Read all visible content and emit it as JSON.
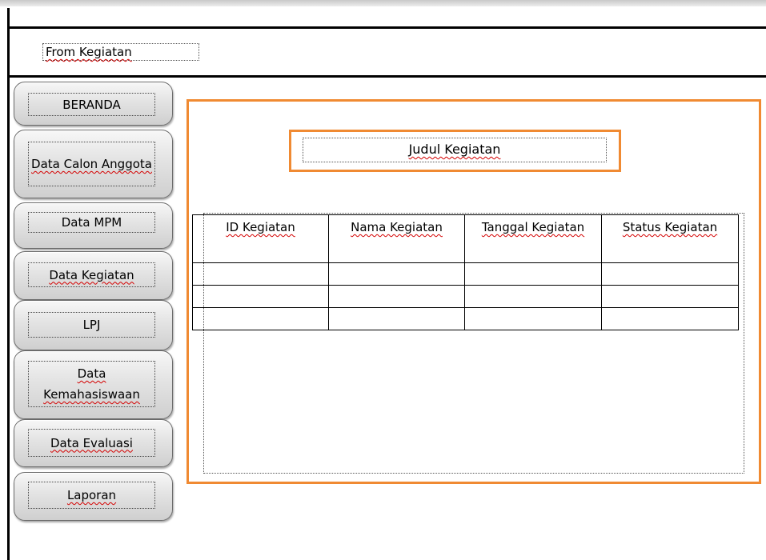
{
  "header": {
    "form_title": "From Kegiatan"
  },
  "sidebar": {
    "items": [
      {
        "label": "BERANDA"
      },
      {
        "label": "Data Calon Anggota"
      },
      {
        "label": "Data MPM"
      },
      {
        "label": "Data Kegiatan"
      },
      {
        "label": "LPJ"
      },
      {
        "label": "Data Kemahasiswaan"
      },
      {
        "label": "Data Evaluasi"
      },
      {
        "label": "Laporan"
      }
    ]
  },
  "main": {
    "heading": "Judul Kegiatan",
    "table": {
      "columns": [
        "ID Kegiatan",
        "Nama Kegiatan",
        "Tanggal Kegiatan",
        "Status Kegiatan"
      ],
      "rows": [
        [
          "",
          "",
          "",
          ""
        ],
        [
          "",
          "",
          "",
          ""
        ],
        [
          "",
          "",
          "",
          ""
        ]
      ]
    }
  },
  "colors": {
    "accent": "#f08a32",
    "border": "#000000"
  }
}
